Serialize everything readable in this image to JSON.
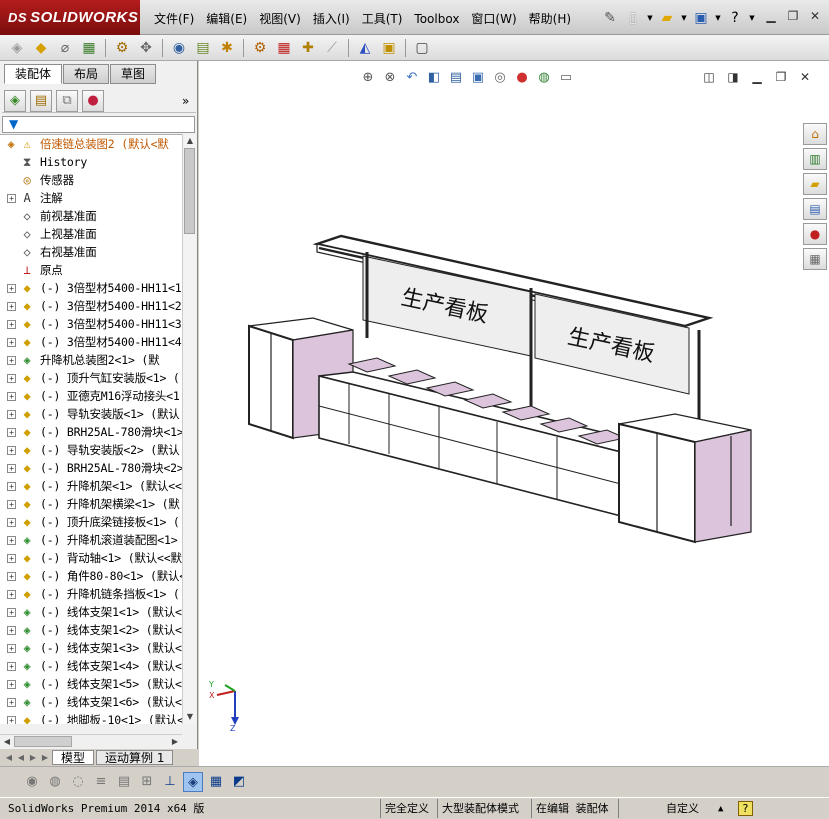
{
  "app": {
    "brand_ds": "DS",
    "brand_name": "SOLIDWORKS"
  },
  "menu": [
    "文件(F)",
    "编辑(E)",
    "视图(V)",
    "插入(I)",
    "工具(T)",
    "Toolbox",
    "窗口(W)",
    "帮助(H)"
  ],
  "icons": {
    "pin": "pin-icon",
    "new": "new-document-icon",
    "open": "open-icon",
    "save": "save-icon",
    "help": "help-icon",
    "minimize": "minimize-icon",
    "restore": "restore-icon",
    "close": "close-icon"
  },
  "panel": {
    "tabs": [
      "装配体",
      "布局",
      "草图"
    ],
    "active_tab": "装配体",
    "more": "»",
    "filter": "▼"
  },
  "tree": [
    {
      "label": "倍速链总装图2  (默认<默",
      "kind": "root",
      "color": "#c05800"
    },
    {
      "label": "History",
      "kind": "history"
    },
    {
      "label": "传感器",
      "kind": "sensor"
    },
    {
      "label": "注解",
      "kind": "annotation",
      "expand": true
    },
    {
      "label": "前视基准面",
      "kind": "plane"
    },
    {
      "label": "上视基准面",
      "kind": "plane"
    },
    {
      "label": "右视基准面",
      "kind": "plane"
    },
    {
      "label": "原点",
      "kind": "origin"
    },
    {
      "label": "(-) 3倍型材5400-HH11<1>",
      "kind": "part"
    },
    {
      "label": "(-) 3倍型材5400-HH11<2>",
      "kind": "part"
    },
    {
      "label": "(-) 3倍型材5400-HH11<3>",
      "kind": "part"
    },
    {
      "label": "(-) 3倍型材5400-HH11<4>",
      "kind": "part"
    },
    {
      "label": "升降机总装图2<1> (默",
      "kind": "asm"
    },
    {
      "label": "(-) 顶升气缸安装版<1> (",
      "kind": "part"
    },
    {
      "label": "(-) 亚德克M16浮动接头<1",
      "kind": "part"
    },
    {
      "label": "(-) 导轨安装版<1> (默认",
      "kind": "part"
    },
    {
      "label": "(-) BRH25AL-780滑块<1>",
      "kind": "part"
    },
    {
      "label": "(-) 导轨安装版<2> (默认",
      "kind": "part"
    },
    {
      "label": "(-) BRH25AL-780滑块<2>",
      "kind": "part"
    },
    {
      "label": "(-) 升降机架<1> (默认<<",
      "kind": "part"
    },
    {
      "label": "(-) 升降机架横梁<1> (默",
      "kind": "part"
    },
    {
      "label": "(-) 顶升底梁链接板<1> (",
      "kind": "part"
    },
    {
      "label": "(-) 升降机滚道装配图<1>",
      "kind": "asm"
    },
    {
      "label": "(-) 背动轴<1> (默认<<默",
      "kind": "part"
    },
    {
      "label": "(-) 角件80-80<1> (默认<",
      "kind": "part"
    },
    {
      "label": "(-) 升降机链条挡板<1> (",
      "kind": "part"
    },
    {
      "label": "(-) 线体支架1<1> (默认<",
      "kind": "asm"
    },
    {
      "label": "(-) 线体支架1<2> (默认<",
      "kind": "asm"
    },
    {
      "label": "(-) 线体支架1<3> (默认<",
      "kind": "asm"
    },
    {
      "label": "(-) 线体支架1<4> (默认<",
      "kind": "asm"
    },
    {
      "label": "(-) 线体支架1<5> (默认<",
      "kind": "asm"
    },
    {
      "label": "(-) 线体支架1<6> (默认<",
      "kind": "asm"
    },
    {
      "label": "(-) 地脚板-10<1> (默认<",
      "kind": "part"
    }
  ],
  "bottom_tabs": [
    "模型",
    "运动算例 1"
  ],
  "viewport": {
    "signs": [
      "生产看板",
      "生产看板"
    ],
    "triad": {
      "x": "X",
      "y": "Y",
      "z": "Z"
    }
  },
  "status": {
    "product": "SolidWorks Premium 2014 x64 版",
    "fully_defined": "完全定义",
    "large_asm": "大型装配体模式",
    "editing": "在编辑 装配体",
    "custom": "自定义",
    "help": "?"
  },
  "colors": {
    "accent_red": "#9b1414",
    "panel_purple": "#dcc4dc",
    "sign_bg": "#eeeeee"
  }
}
